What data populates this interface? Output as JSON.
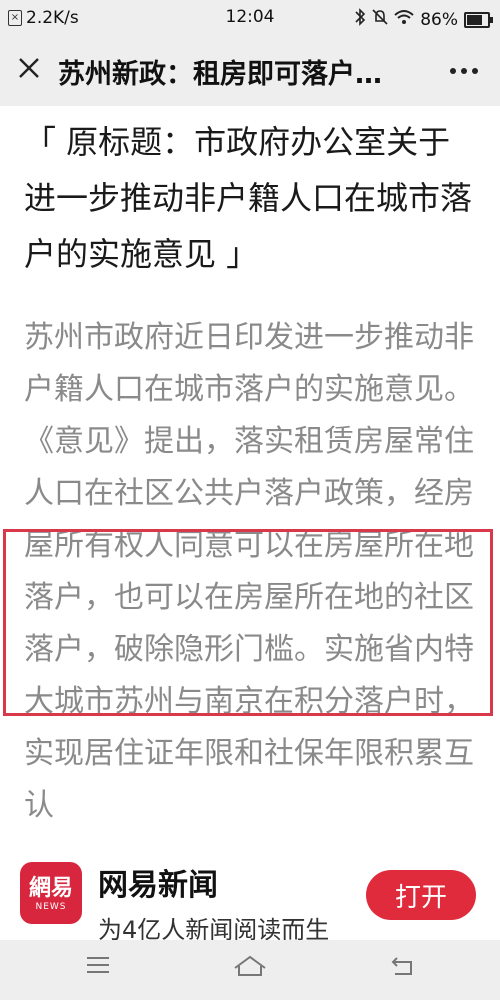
{
  "status_bar": {
    "network_speed": "2.2K/s",
    "time": "12:04",
    "battery_percent": "86%",
    "battery_level": 0.86
  },
  "title_bar": {
    "title": "苏州新政：租房即可落户…"
  },
  "article": {
    "headline": "「 原标题：市政府办公室关于进一步推动非户籍人口在城市落户的实施意见 」",
    "body": "苏州市政府近日印发进一步推动非户籍人口在城市落户的实施意见。《意见》提出，落实租赁房屋常住人口在社区公共户落户政策，经房屋所有权人同意可以在房屋所在地落户，也可以在房屋所在地的社区落户，破除隐形门槛。实施省内特大城市苏州与南京在积分落户时，实现居住证年限和社保年限积累互认"
  },
  "app_banner": {
    "logo_text": "網易",
    "logo_sub": "NEWS",
    "app_name": "网易新闻",
    "slogan": "为4亿人新闻阅读而生",
    "open_label": "打开"
  },
  "colors": {
    "accent": "#e02b3c",
    "highlight_border": "#d9384a",
    "body_text": "#8a8a8a"
  },
  "icons": {
    "close": "close-icon",
    "more": "more-icon",
    "menu": "menu-icon",
    "home": "home-icon",
    "back": "back-icon"
  }
}
